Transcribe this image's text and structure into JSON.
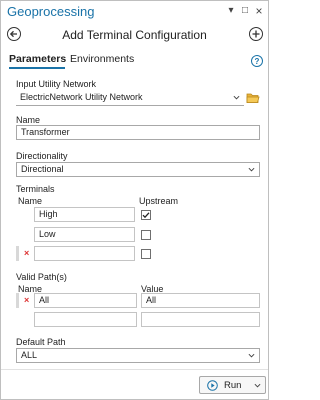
{
  "pane": {
    "title": "Geoprocessing",
    "controls": {
      "pin": "▾",
      "restore": "□",
      "close": "×"
    }
  },
  "tool": {
    "title": "Add Terminal Configuration",
    "back_icon": "back-arrow-icon",
    "add_icon": "plus-icon"
  },
  "tabs": [
    {
      "label": "Parameters",
      "active": true
    },
    {
      "label": "Environments",
      "active": false
    }
  ],
  "help_glyph": "?",
  "params": {
    "input_network": {
      "label": "Input Utility Network",
      "value": "ElectricNetwork Utility Network"
    },
    "name": {
      "label": "Name",
      "value": "Transformer"
    },
    "directionality": {
      "label": "Directionality",
      "value": "Directional"
    },
    "terminals": {
      "label": "Terminals",
      "col_name": "Name",
      "col_upstream": "Upstream",
      "rows": [
        {
          "name": "High",
          "upstream": true
        },
        {
          "name": "Low",
          "upstream": false
        },
        {
          "name": "",
          "upstream": false
        }
      ]
    },
    "valid_paths": {
      "label": "Valid Path(s)",
      "col_name": "Name",
      "col_value": "Value",
      "rows": [
        {
          "name": "All",
          "value": "All"
        },
        {
          "name": "",
          "value": ""
        }
      ]
    },
    "default_path": {
      "label": "Default Path",
      "value": "ALL"
    }
  },
  "run": {
    "label": "Run"
  },
  "colors": {
    "accent": "#1a73a8",
    "delete": "#d33333"
  }
}
